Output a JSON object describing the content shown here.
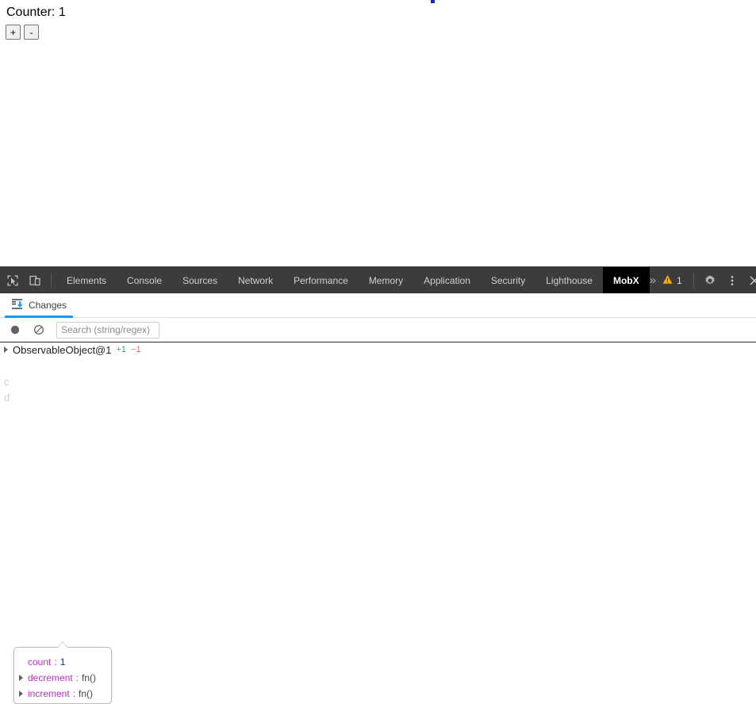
{
  "page": {
    "counter_label": "Counter: 1",
    "increment_button": "+",
    "decrement_button": "-"
  },
  "devtools": {
    "toolbar": {
      "inspect_icon": "inspect-element-icon",
      "device_icon": "device-toolbar-icon",
      "tabs": [
        {
          "label": "Elements",
          "active": false
        },
        {
          "label": "Console",
          "active": false
        },
        {
          "label": "Sources",
          "active": false
        },
        {
          "label": "Network",
          "active": false
        },
        {
          "label": "Performance",
          "active": false
        },
        {
          "label": "Memory",
          "active": false
        },
        {
          "label": "Application",
          "active": false
        },
        {
          "label": "Security",
          "active": false
        },
        {
          "label": "Lighthouse",
          "active": false
        },
        {
          "label": "MobX",
          "active": true
        }
      ],
      "more_tabs_label": "»",
      "warning_count": "1",
      "settings_icon": "gear-icon",
      "menu_icon": "more-vertical-icon",
      "close_icon": "close-icon"
    },
    "subtabs": [
      {
        "label": "Changes",
        "active": true,
        "icon": "changes-icon"
      }
    ],
    "actionbar": {
      "record_icon": "record-circle-icon",
      "clear_icon": "clear-prohibited-icon",
      "search_placeholder": "Search (string/regex)",
      "search_value": ""
    },
    "changes": {
      "root": {
        "label": "ObservableObject@1",
        "added": "+1",
        "removed": "−1"
      },
      "popup": {
        "rows": [
          {
            "key": "count",
            "value": "1",
            "type": "number",
            "expandable": false
          },
          {
            "key": "decrement",
            "value": "fn()",
            "type": "function",
            "expandable": true
          },
          {
            "key": "increment",
            "value": "fn()",
            "type": "function",
            "expandable": true
          }
        ]
      }
    }
  },
  "colors": {
    "toolbar_bg": "#3c3c3c",
    "active_tab_bg": "#000000",
    "accent_blue": "#1a9af5",
    "added_green": "#3aa757",
    "removed_red": "#e06c6c",
    "key_purple": "#b730c4",
    "warning_orange": "#f0ad1e"
  }
}
